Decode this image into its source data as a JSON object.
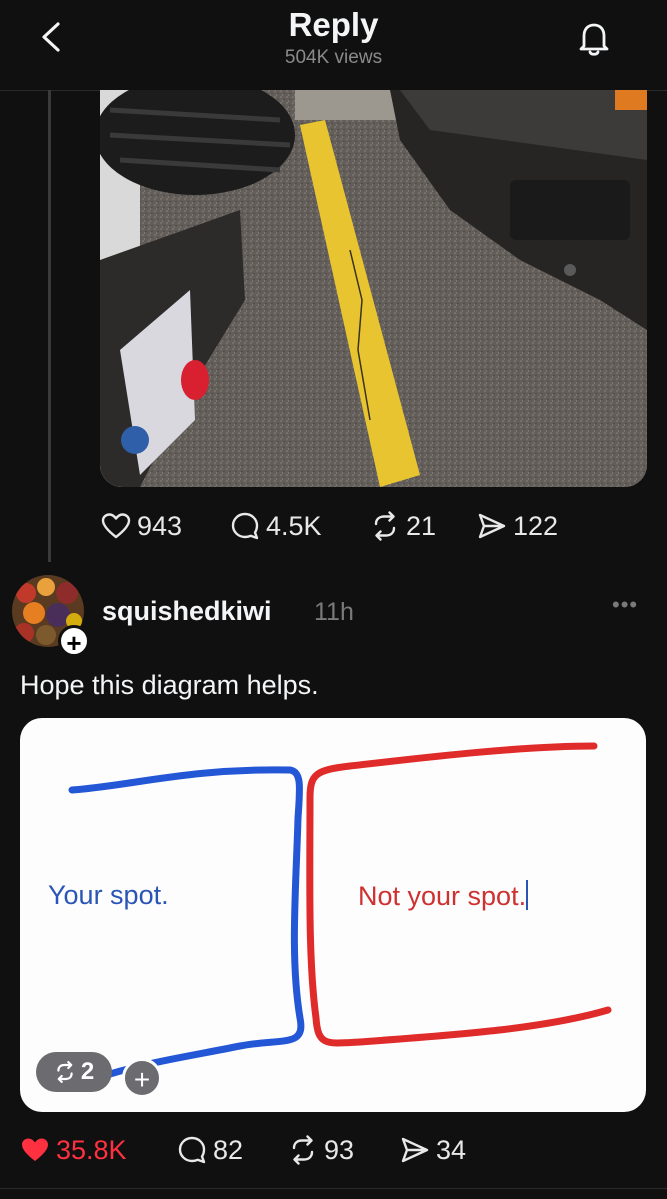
{
  "header": {
    "title": "Reply",
    "views": "504K views"
  },
  "original_post": {
    "stats": {
      "likes": "943",
      "replies": "4.5K",
      "reposts": "21",
      "shares": "122"
    }
  },
  "reply": {
    "username": "squishedkiwi",
    "time": "11h",
    "text": "Hope this diagram helps.",
    "diagram": {
      "left_label": "Your spot.",
      "right_label": "Not your spot.",
      "left_color": "#2457d6",
      "right_color": "#e02b2b"
    },
    "repost_badge": "2",
    "stats": {
      "likes": "35.8K",
      "replies": "82",
      "reposts": "93",
      "shares": "34"
    },
    "like_color": "#ff3040"
  }
}
